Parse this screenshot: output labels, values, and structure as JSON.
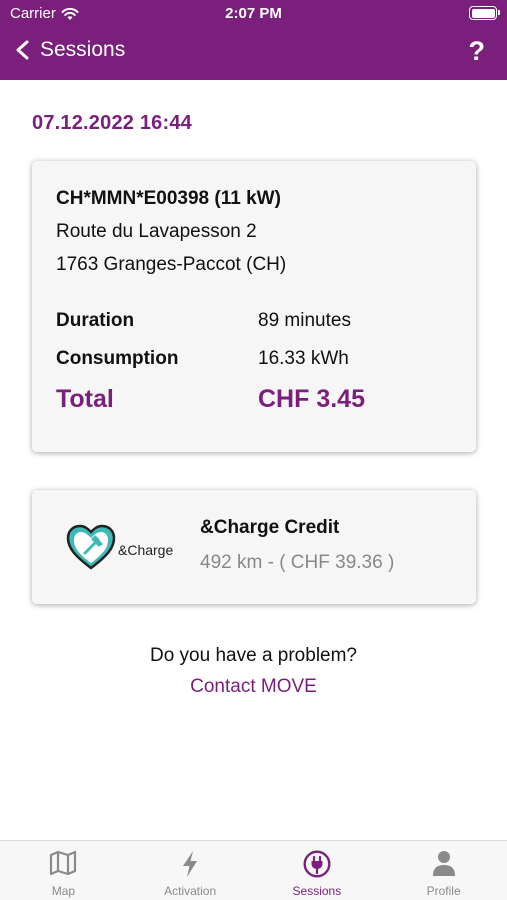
{
  "status_bar": {
    "carrier": "Carrier",
    "time": "2:07 PM"
  },
  "nav": {
    "back_label": "Sessions",
    "help_label": "?"
  },
  "session": {
    "date": "07.12.2022 16:44",
    "station_id": "CH*MMN*E00398 (11 kW)",
    "address_line1": "Route du Lavapesson 2",
    "address_line2": "1763 Granges-Paccot (CH)",
    "duration_label": "Duration",
    "duration_value": "89 minutes",
    "consumption_label": "Consumption",
    "consumption_value": "16.33 kWh",
    "total_label": "Total",
    "total_value": "CHF 3.45"
  },
  "credit": {
    "logo_text": "&Charge",
    "title": "&Charge Credit",
    "value": "492 km  - ( CHF 39.36 )"
  },
  "help": {
    "question": "Do you have a problem?",
    "contact_label": "Contact MOVE"
  },
  "tabs": [
    {
      "label": "Map",
      "icon": "map-icon"
    },
    {
      "label": "Activation",
      "icon": "lightning-icon"
    },
    {
      "label": "Sessions",
      "icon": "plug-icon",
      "active": true
    },
    {
      "label": "Profile",
      "icon": "person-icon"
    }
  ],
  "colors": {
    "brand": "#7b1f7c",
    "logo_teal": "#3fb8b8"
  }
}
